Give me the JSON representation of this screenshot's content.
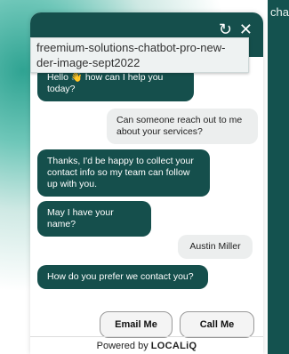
{
  "background": {
    "corner_text": "cha"
  },
  "header": {
    "tooltip": "freemium-solutions-chatbot-pro-new-der-image-sept2022",
    "refresh_icon": "refresh-icon",
    "close_icon": "close-icon"
  },
  "messages": [
    {
      "from": "bot",
      "text": "Hello 👋 how can I help you today?"
    },
    {
      "from": "user",
      "text": "Can someone reach out to me about your services?"
    },
    {
      "from": "bot",
      "text": "Thanks, I'd be happy to collect your contact info so my team can follow up with you."
    },
    {
      "from": "bot",
      "text": "May I have your name?"
    },
    {
      "from": "user",
      "text": "Austin Miller"
    },
    {
      "from": "bot",
      "text": "How do you prefer we contact you?"
    }
  ],
  "buttons": {
    "email": "Email Me",
    "call": "Call Me"
  },
  "footer": {
    "prefix": "Powered by",
    "brand": "LOCALiQ"
  },
  "colors": {
    "bot_bubble": "#154f4c",
    "user_bubble": "#eceeee",
    "header": "#154f4c"
  }
}
